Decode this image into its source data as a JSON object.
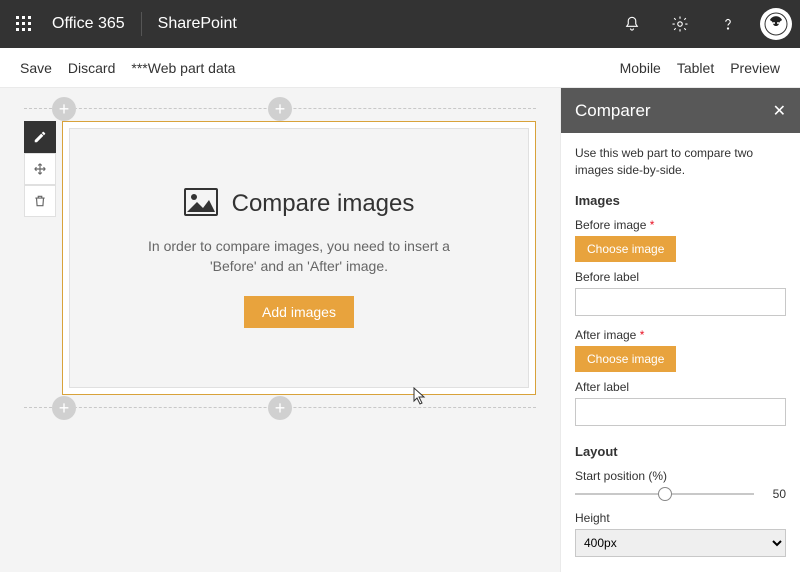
{
  "suite": {
    "product": "Office 365",
    "app": "SharePoint"
  },
  "commandBar": {
    "save": "Save",
    "discard": "Discard",
    "data": "***Web part data",
    "mobile": "Mobile",
    "tablet": "Tablet",
    "preview": "Preview"
  },
  "webpart": {
    "title": "Compare images",
    "description": "In order to compare images, you need to insert a 'Before' and an 'After' image.",
    "addButton": "Add images"
  },
  "panel": {
    "title": "Comparer",
    "description": "Use this web part to compare two images side-by-side.",
    "groups": {
      "images": "Images",
      "layout": "Layout"
    },
    "before": {
      "label": "Before image",
      "button": "Choose image",
      "textLabel": "Before label",
      "value": ""
    },
    "after": {
      "label": "After image",
      "button": "Choose image",
      "textLabel": "After label",
      "value": ""
    },
    "startPos": {
      "label": "Start position (%)",
      "value": "50"
    },
    "height": {
      "label": "Height",
      "value": "400px"
    }
  },
  "colors": {
    "accent": "#e8a33d"
  }
}
